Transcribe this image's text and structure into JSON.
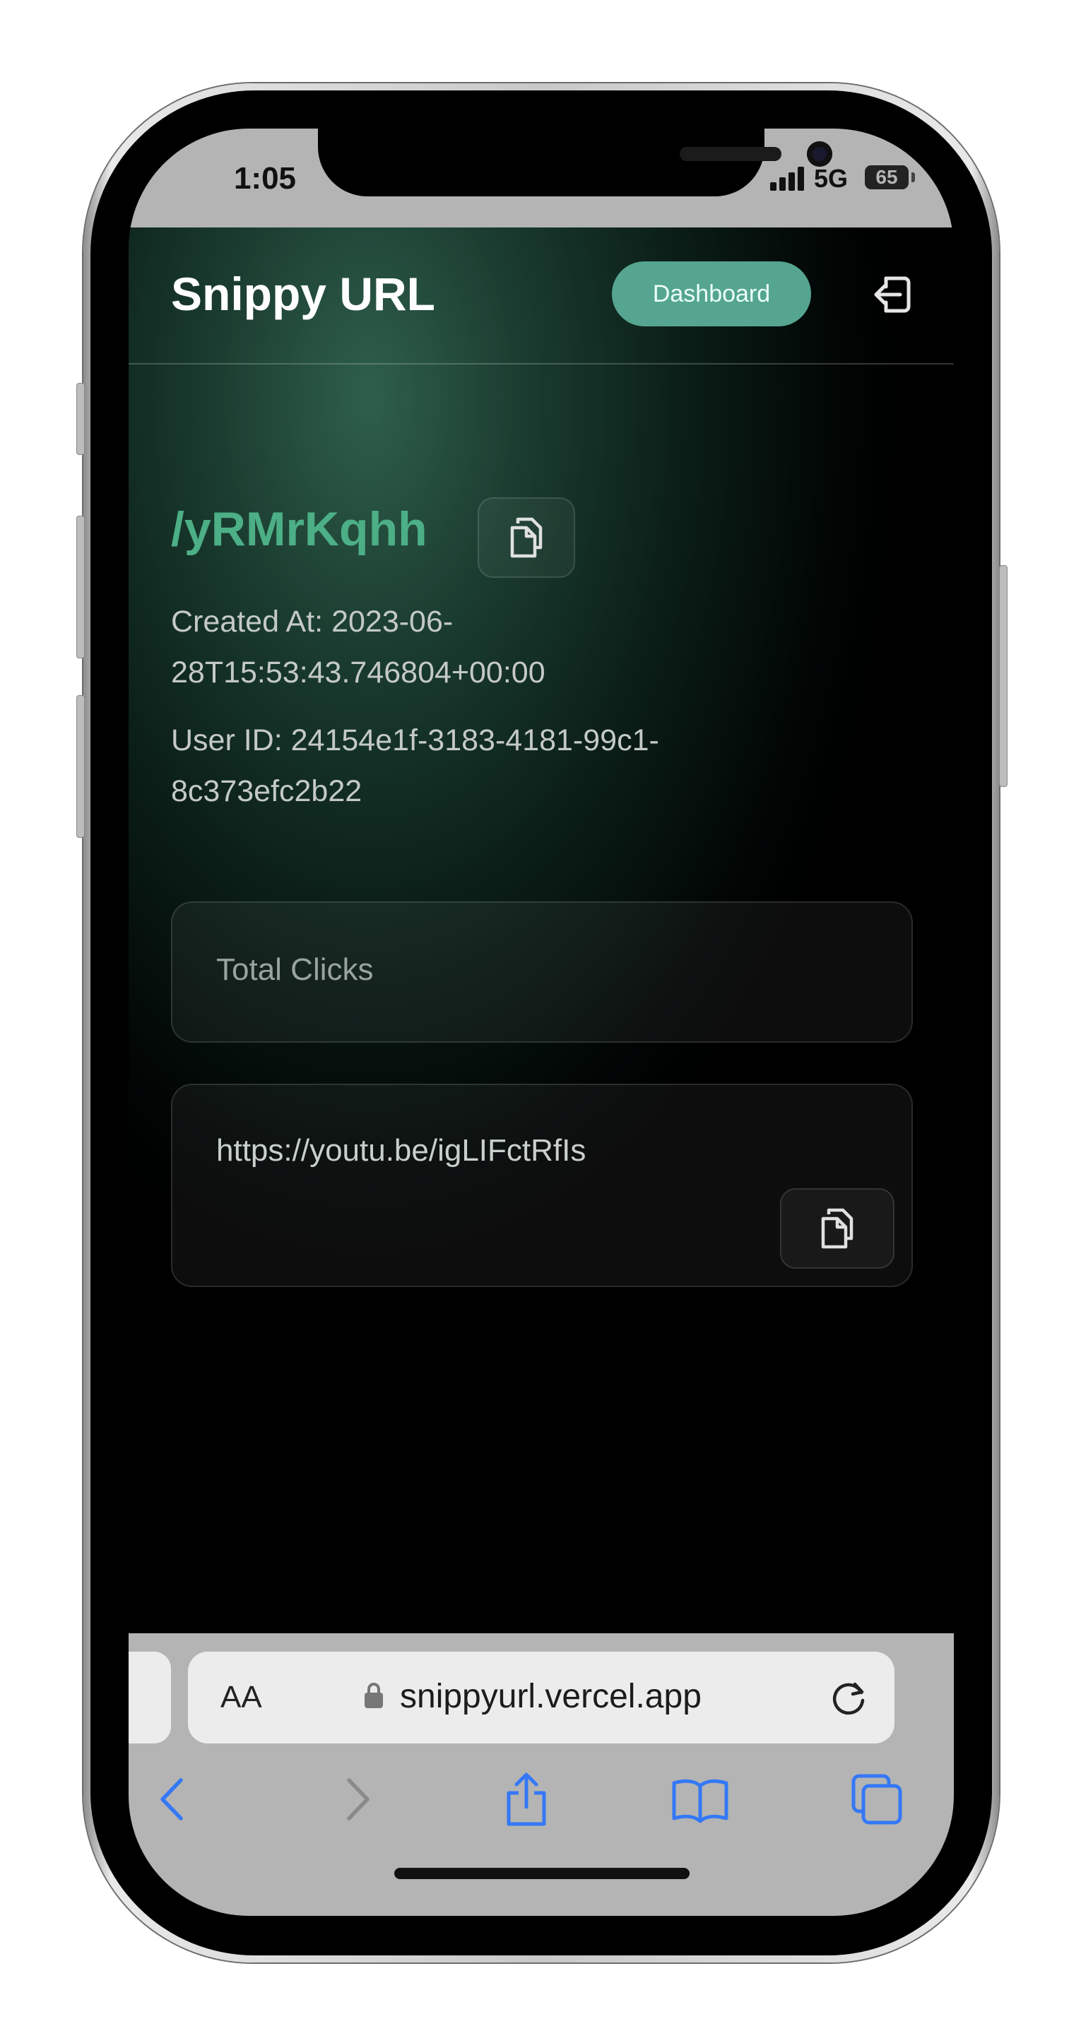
{
  "status_bar": {
    "time": "1:05",
    "network": "5G",
    "battery": "65"
  },
  "header": {
    "brand": "Snippy URL",
    "dashboard_label": "Dashboard",
    "logout_icon": "logout-icon"
  },
  "link": {
    "slug": "/yRMrKqhh",
    "created_at": "Created At: 2023-06-28T15:53:43.746804+00:00",
    "user_id": "User ID: 24154e1f-3183-4181-99c1-8c373efc2b22",
    "copy_icon": "copy-icon"
  },
  "stats": {
    "total_clicks_label": "Total Clicks"
  },
  "destination": {
    "url": "https://youtu.be/igLIFctRfIs",
    "copy_icon": "copy-icon"
  },
  "browser": {
    "text_size_label": "AA",
    "domain": "snippyurl.vercel.app",
    "icons": [
      "back-icon",
      "forward-icon",
      "share-icon",
      "bookmarks-icon",
      "tabs-icon"
    ]
  },
  "colors": {
    "accent": "#4caf86",
    "button": "#55a590",
    "ios_blue": "#3478f6"
  }
}
